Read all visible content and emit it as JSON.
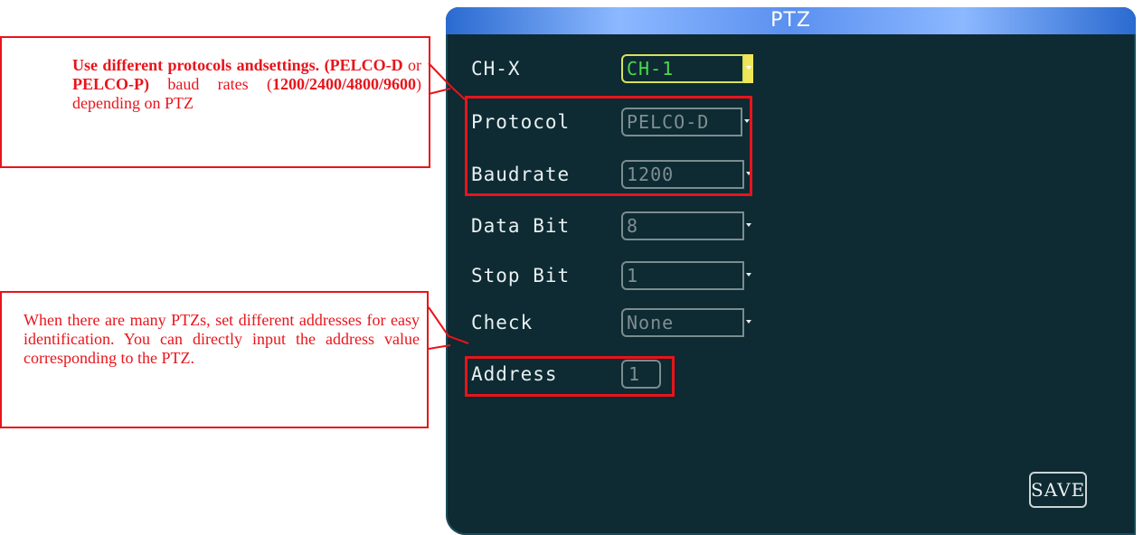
{
  "screen": {
    "title": "PTZ",
    "fields": [
      {
        "label": "CH-X",
        "value": "CH-1"
      },
      {
        "label": "Protocol",
        "value": "PELCO-D"
      },
      {
        "label": "Baudrate",
        "value": "1200"
      },
      {
        "label": "Data Bit",
        "value": "8"
      },
      {
        "label": "Stop Bit",
        "value": "1"
      },
      {
        "label": "Check",
        "value": "None"
      },
      {
        "label": "Address",
        "value": "1"
      }
    ],
    "save_label": "SAVE"
  },
  "callouts": {
    "protocols": {
      "p1": "Use different protocols andsettings.",
      "p2": "(PELCO-D",
      "p3": " or ",
      "p4": "PELCO-P)",
      "p5": " baud rates (",
      "p6": "1200/2400/4800/9600",
      "p7": ") depending on PTZ"
    },
    "address": "When there are many PTZs, set different addresses for easy identification. You can directly input the address value corresponding to the PTZ."
  },
  "colors": {
    "annotation": "#e8141b",
    "screen_bg": "#0e2a32",
    "title_bar": "#5a90ef",
    "active_value": "#4bd94b",
    "active_border": "#d7e35a"
  }
}
